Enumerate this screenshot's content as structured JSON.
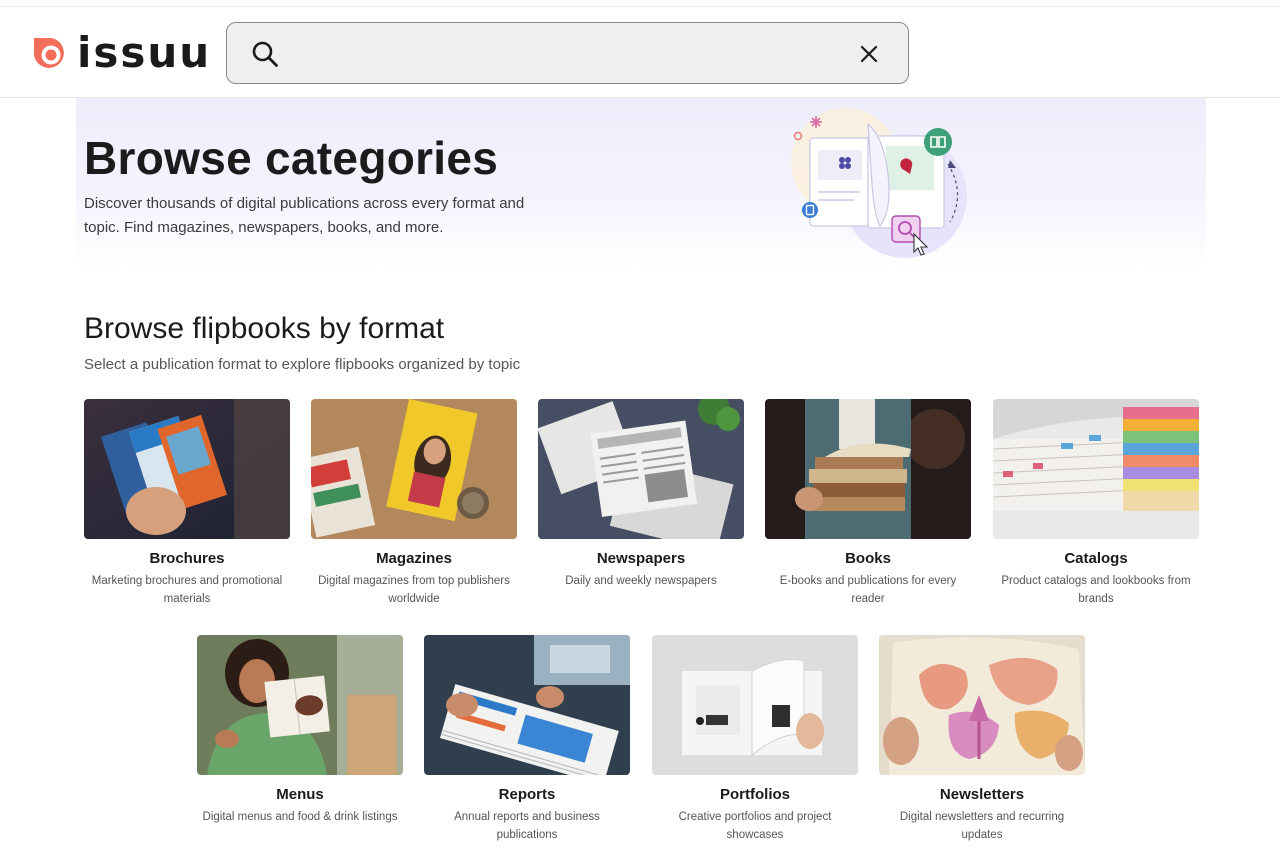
{
  "header": {
    "logo_text": "issuu",
    "search": {
      "value": "",
      "placeholder": ""
    }
  },
  "hero": {
    "title": "Browse categories",
    "description": "Discover thousands of digital publications across every format and topic. Find magazines, newspapers, books, and more."
  },
  "formats": {
    "title": "Browse flipbooks by format",
    "subtitle": "Select a publication format to explore flipbooks organized by topic",
    "items": [
      {
        "title": "Brochures",
        "description": "Marketing brochures and promotional materials"
      },
      {
        "title": "Magazines",
        "description": "Digital magazines from top publishers worldwide"
      },
      {
        "title": "Newspapers",
        "description": "Daily and weekly newspapers"
      },
      {
        "title": "Books",
        "description": "E-books and publications for every reader"
      },
      {
        "title": "Catalogs",
        "description": "Product catalogs and lookbooks from brands"
      },
      {
        "title": "Menus",
        "description": "Digital menus and food & drink listings"
      },
      {
        "title": "Reports",
        "description": "Annual reports and business publications"
      },
      {
        "title": "Portfolios",
        "description": "Creative portfolios and project showcases"
      },
      {
        "title": "Newsletters",
        "description": "Digital newsletters and recurring updates"
      }
    ]
  },
  "colors": {
    "brand": "#f36d5b",
    "text": "#1a1a1a",
    "hero_bg": "#eeedfb"
  }
}
